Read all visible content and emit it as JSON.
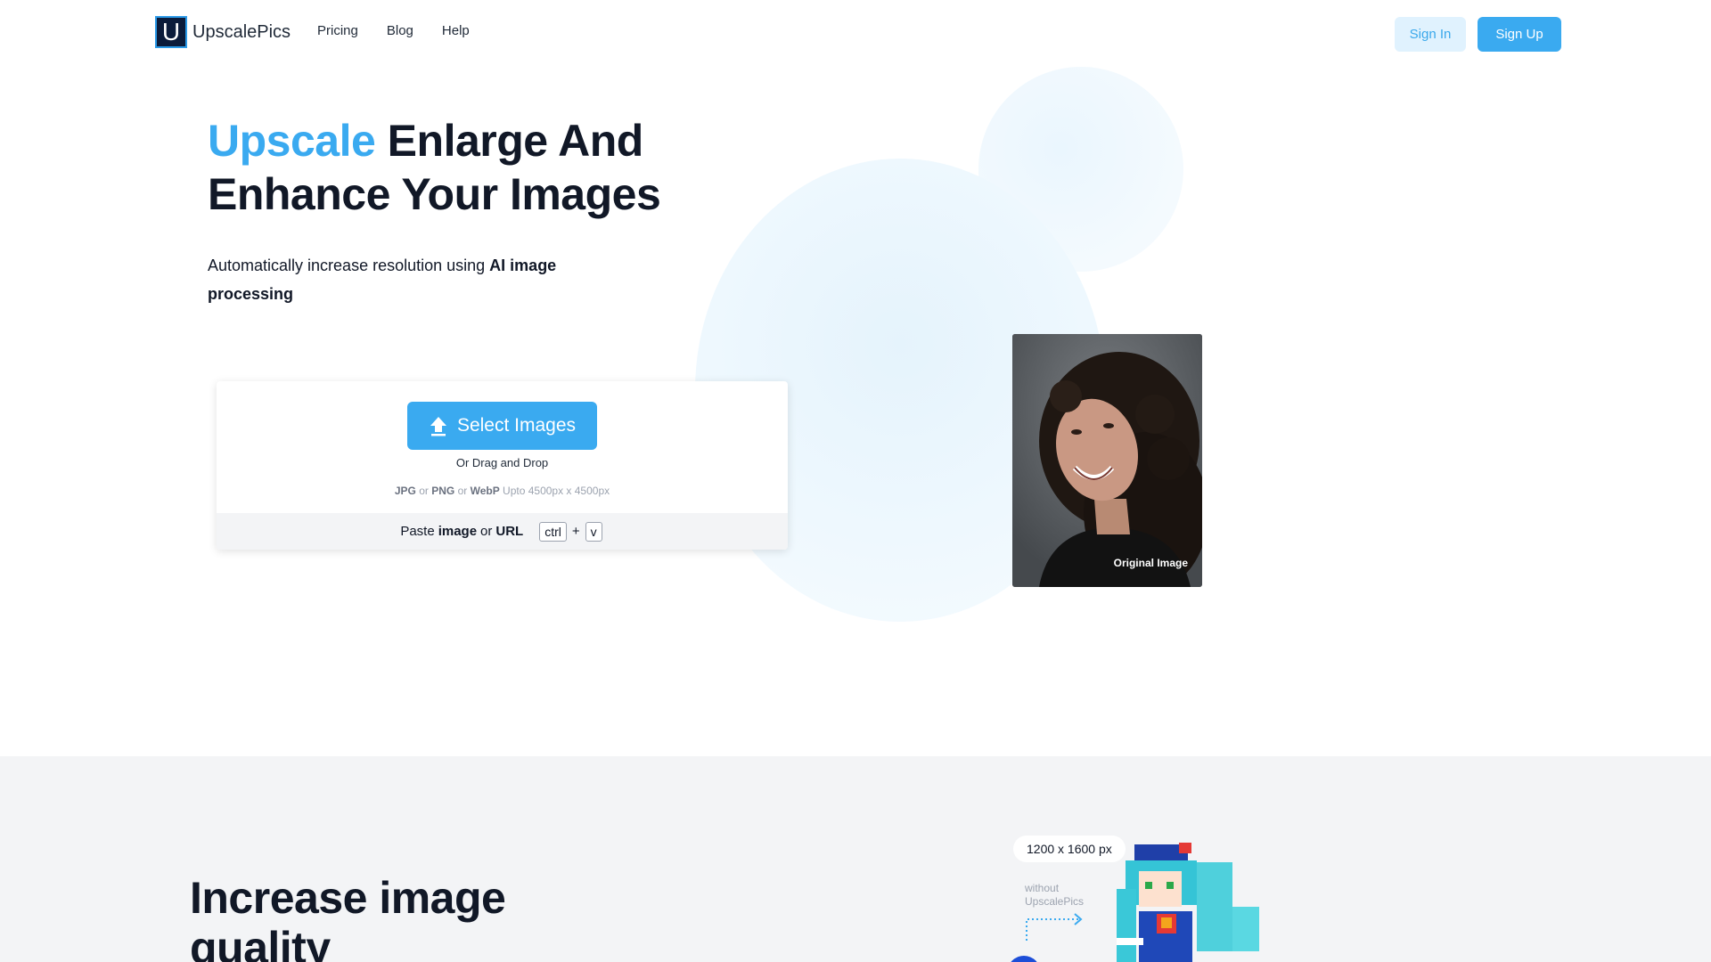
{
  "nav": {
    "logo_letter": "U",
    "brand": "UpscalePics",
    "links": [
      "Pricing",
      "Blog",
      "Help"
    ],
    "sign_in": "Sign In",
    "sign_up": "Sign Up"
  },
  "hero": {
    "title_accent": "Upscale",
    "title_rest_line1": " Enlarge And",
    "title_line2": "Enhance Your Images",
    "subtitle_plain": "Automatically increase resolution using ",
    "subtitle_bold": "AI image processing"
  },
  "upload": {
    "select_button": "Select Images",
    "drag_text": "Or Drag and Drop",
    "format_jpg": "JPG",
    "format_or1": " or ",
    "format_png": "PNG",
    "format_or2": " or ",
    "format_webp": "WebP",
    "format_limit": " Upto 4500px x 4500px",
    "paste_prefix": "Paste",
    "paste_image": "image",
    "paste_or": "or",
    "paste_url": "URL",
    "key_ctrl": "ctrl",
    "key_plus": "+",
    "key_v": "v"
  },
  "preview": {
    "label": "Original Image"
  },
  "section2": {
    "title": "Increase image quality",
    "size_pill": "1200 x 1600 px",
    "without_line1": "without",
    "without_line2": "UpscalePics"
  },
  "colors": {
    "accent": "#3aaaf0",
    "accent_light": "#e0f2fe",
    "text": "#111827",
    "section_bg": "#f3f4f6"
  }
}
